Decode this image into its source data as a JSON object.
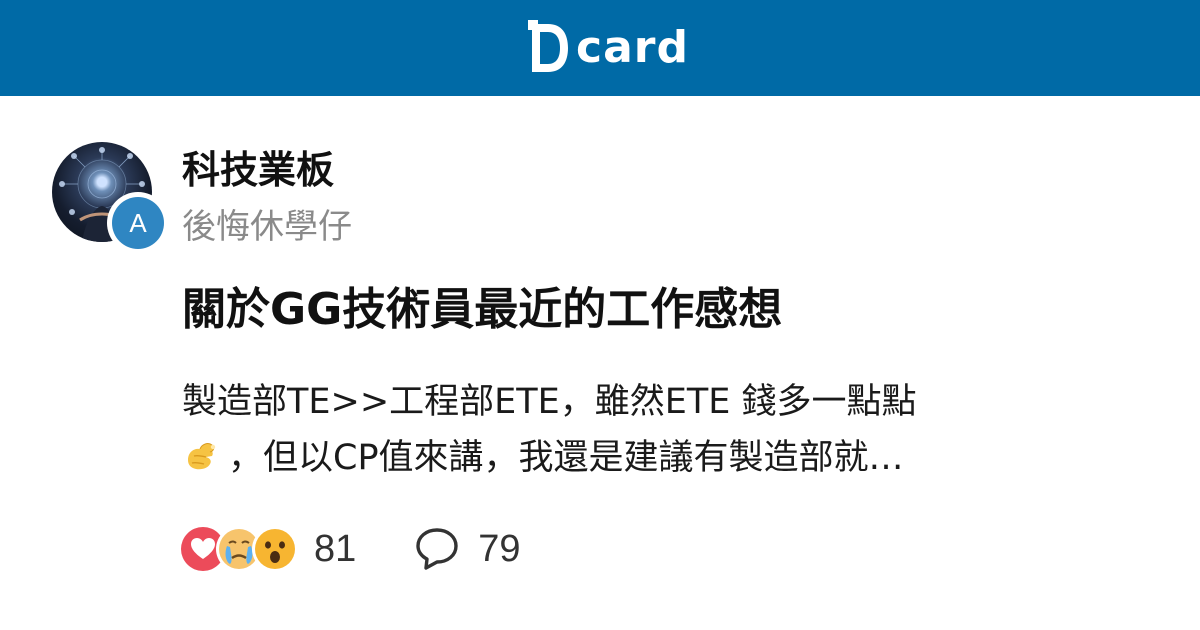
{
  "header": {
    "brand": "card",
    "brand_color": "#006aa6"
  },
  "forum": {
    "name": "科技業板",
    "avatar_icon": "forum-avatar-tech"
  },
  "author": {
    "initial": "A",
    "name": "後悔休學仔",
    "badge_color": "#2f86c2"
  },
  "post": {
    "title": "關於GG技術員最近的工作感想",
    "excerpt_line1": "製造部TE>>工程部ETE，雖然ETE 錢多一點點",
    "excerpt_line2": "，但以CP值來講，我還是建議有製造部就…",
    "excerpt_emoji": "pinching-hand-emoji"
  },
  "stats": {
    "reaction_icons": [
      "heart-icon",
      "crying-face-icon",
      "surprised-face-icon"
    ],
    "reaction_count": "81",
    "comment_icon": "comment-bubble-icon",
    "comment_count": "79"
  }
}
